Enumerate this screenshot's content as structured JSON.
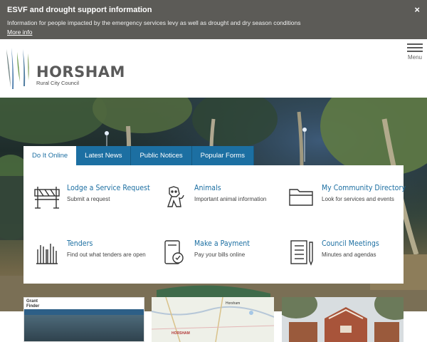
{
  "alert": {
    "title": "ESVF and drought support information",
    "text": "Information for people impacted by the emergency services levy as well as drought and dry season conditions",
    "link": "More info",
    "close": "×"
  },
  "header": {
    "logo_name": "HORSHAM",
    "logo_sub": "Rural City Council",
    "menu_label": "Menu"
  },
  "tabs": [
    {
      "label": "Do It Online",
      "active": true
    },
    {
      "label": "Latest News"
    },
    {
      "label": "Public Notices"
    },
    {
      "label": "Popular Forms"
    }
  ],
  "items": [
    {
      "title": "Lodge a Service Request",
      "desc": "Submit a request",
      "icon": "barrier-icon"
    },
    {
      "title": "Animals",
      "desc": "Important animal information",
      "icon": "dog-icon"
    },
    {
      "title": "My Community Directory",
      "desc": "Look for services and events",
      "icon": "folder-icon"
    },
    {
      "title": "Tenders",
      "desc": "Find out what tenders are open",
      "icon": "raised-hands-icon"
    },
    {
      "title": "Make a Payment",
      "desc": "Pay your bills online",
      "icon": "payment-icon"
    },
    {
      "title": "Council Meetings",
      "desc": "Minutes and agendas",
      "icon": "minutes-icon"
    }
  ],
  "cards": {
    "grant_finder": "Grant Finder",
    "map_labels": [
      "Horsham",
      "HORSHAM"
    ]
  },
  "colors": {
    "alert_bg": "#5c5b57",
    "brand_blue": "#1c6fa2",
    "logo_blue": "#5b87b3",
    "logo_green": "#6a9a4c"
  }
}
